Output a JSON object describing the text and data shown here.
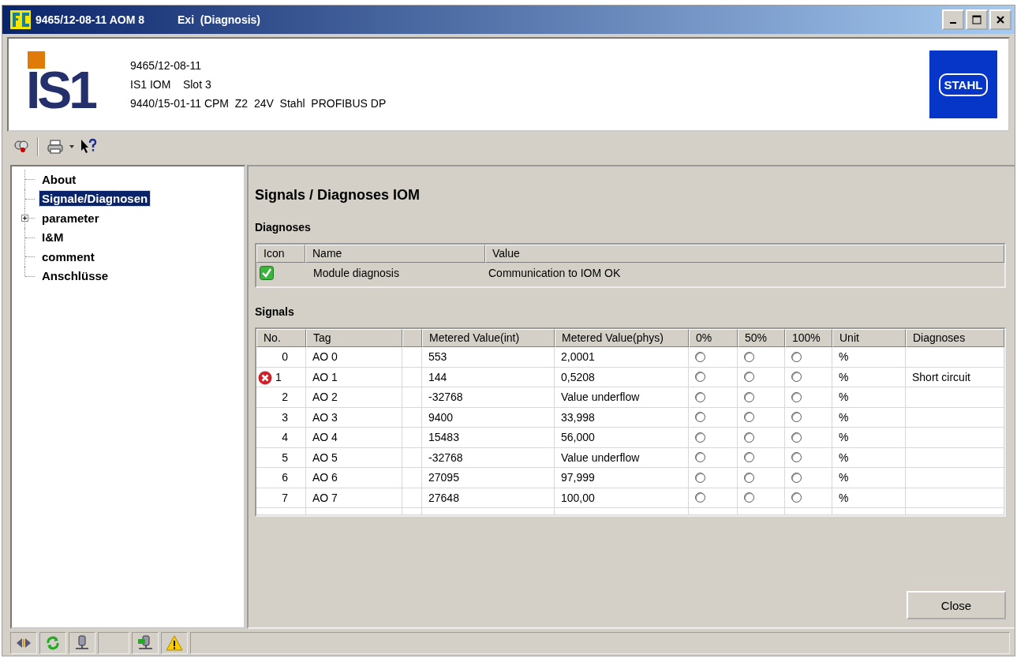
{
  "window": {
    "title": "9465/12-08-11 AOM 8",
    "subtitle": "Exi  (Diagnosis)"
  },
  "header": {
    "logo_text": "IS1",
    "lines": [
      "9465/12-08-11",
      "IS1 IOM    Slot 3",
      "9440/15-01-11 CPM  Z2  24V  Stahl  PROFIBUS DP"
    ],
    "brand": "STAHL"
  },
  "tree": [
    {
      "label": "About",
      "selected": false,
      "expandable": false
    },
    {
      "label": "Signale/Diagnosen",
      "selected": true,
      "expandable": false
    },
    {
      "label": "parameter",
      "selected": false,
      "expandable": true
    },
    {
      "label": "I&M",
      "selected": false,
      "expandable": false
    },
    {
      "label": "comment",
      "selected": false,
      "expandable": false
    },
    {
      "label": "Anschlüsse",
      "selected": false,
      "expandable": false
    }
  ],
  "page_title": "Signals / Diagnoses IOM",
  "diagnoses": {
    "heading": "Diagnoses",
    "columns": [
      "Icon",
      "Name",
      "Value"
    ],
    "rows": [
      {
        "kind": "ok",
        "name": "Module diagnosis",
        "value": "Communication to IOM OK"
      }
    ]
  },
  "signals": {
    "heading": "Signals",
    "columns": [
      "No.",
      "Tag",
      "Metered Value(int)",
      "Metered Value(phys)",
      "0%",
      "50%",
      "100%",
      "Unit",
      "Diagnoses"
    ],
    "rows": [
      {
        "kind": "none",
        "no": "0",
        "tag": "AO 0",
        "int": "553",
        "phys": "2,0001",
        "radios": [
          false,
          false,
          false
        ],
        "unit": "%",
        "diag": ""
      },
      {
        "kind": "error",
        "no": "1",
        "tag": "AO 1",
        "int": "144",
        "phys": "0,5208",
        "radios": [
          false,
          false,
          false
        ],
        "unit": "%",
        "diag": "Short circuit"
      },
      {
        "kind": "none",
        "no": "2",
        "tag": "AO 2",
        "int": "-32768",
        "phys": "Value underflow",
        "radios": [
          false,
          false,
          false
        ],
        "unit": "%",
        "diag": ""
      },
      {
        "kind": "none",
        "no": "3",
        "tag": "AO 3",
        "int": "9400",
        "phys": "33,998",
        "radios": [
          false,
          false,
          false
        ],
        "unit": "%",
        "diag": ""
      },
      {
        "kind": "none",
        "no": "4",
        "tag": "AO 4",
        "int": "15483",
        "phys": "56,000",
        "radios": [
          false,
          false,
          false
        ],
        "unit": "%",
        "diag": ""
      },
      {
        "kind": "none",
        "no": "5",
        "tag": "AO 5",
        "int": "-32768",
        "phys": "Value underflow",
        "radios": [
          false,
          false,
          false
        ],
        "unit": "%",
        "diag": ""
      },
      {
        "kind": "none",
        "no": "6",
        "tag": "AO 6",
        "int": "27095",
        "phys": "97,999",
        "radios": [
          false,
          false,
          false
        ],
        "unit": "%",
        "diag": ""
      },
      {
        "kind": "none",
        "no": "7",
        "tag": "AO 7",
        "int": "27648",
        "phys": "100,00",
        "radios": [
          false,
          false,
          false
        ],
        "unit": "%",
        "diag": ""
      }
    ]
  },
  "close_button": "Close"
}
